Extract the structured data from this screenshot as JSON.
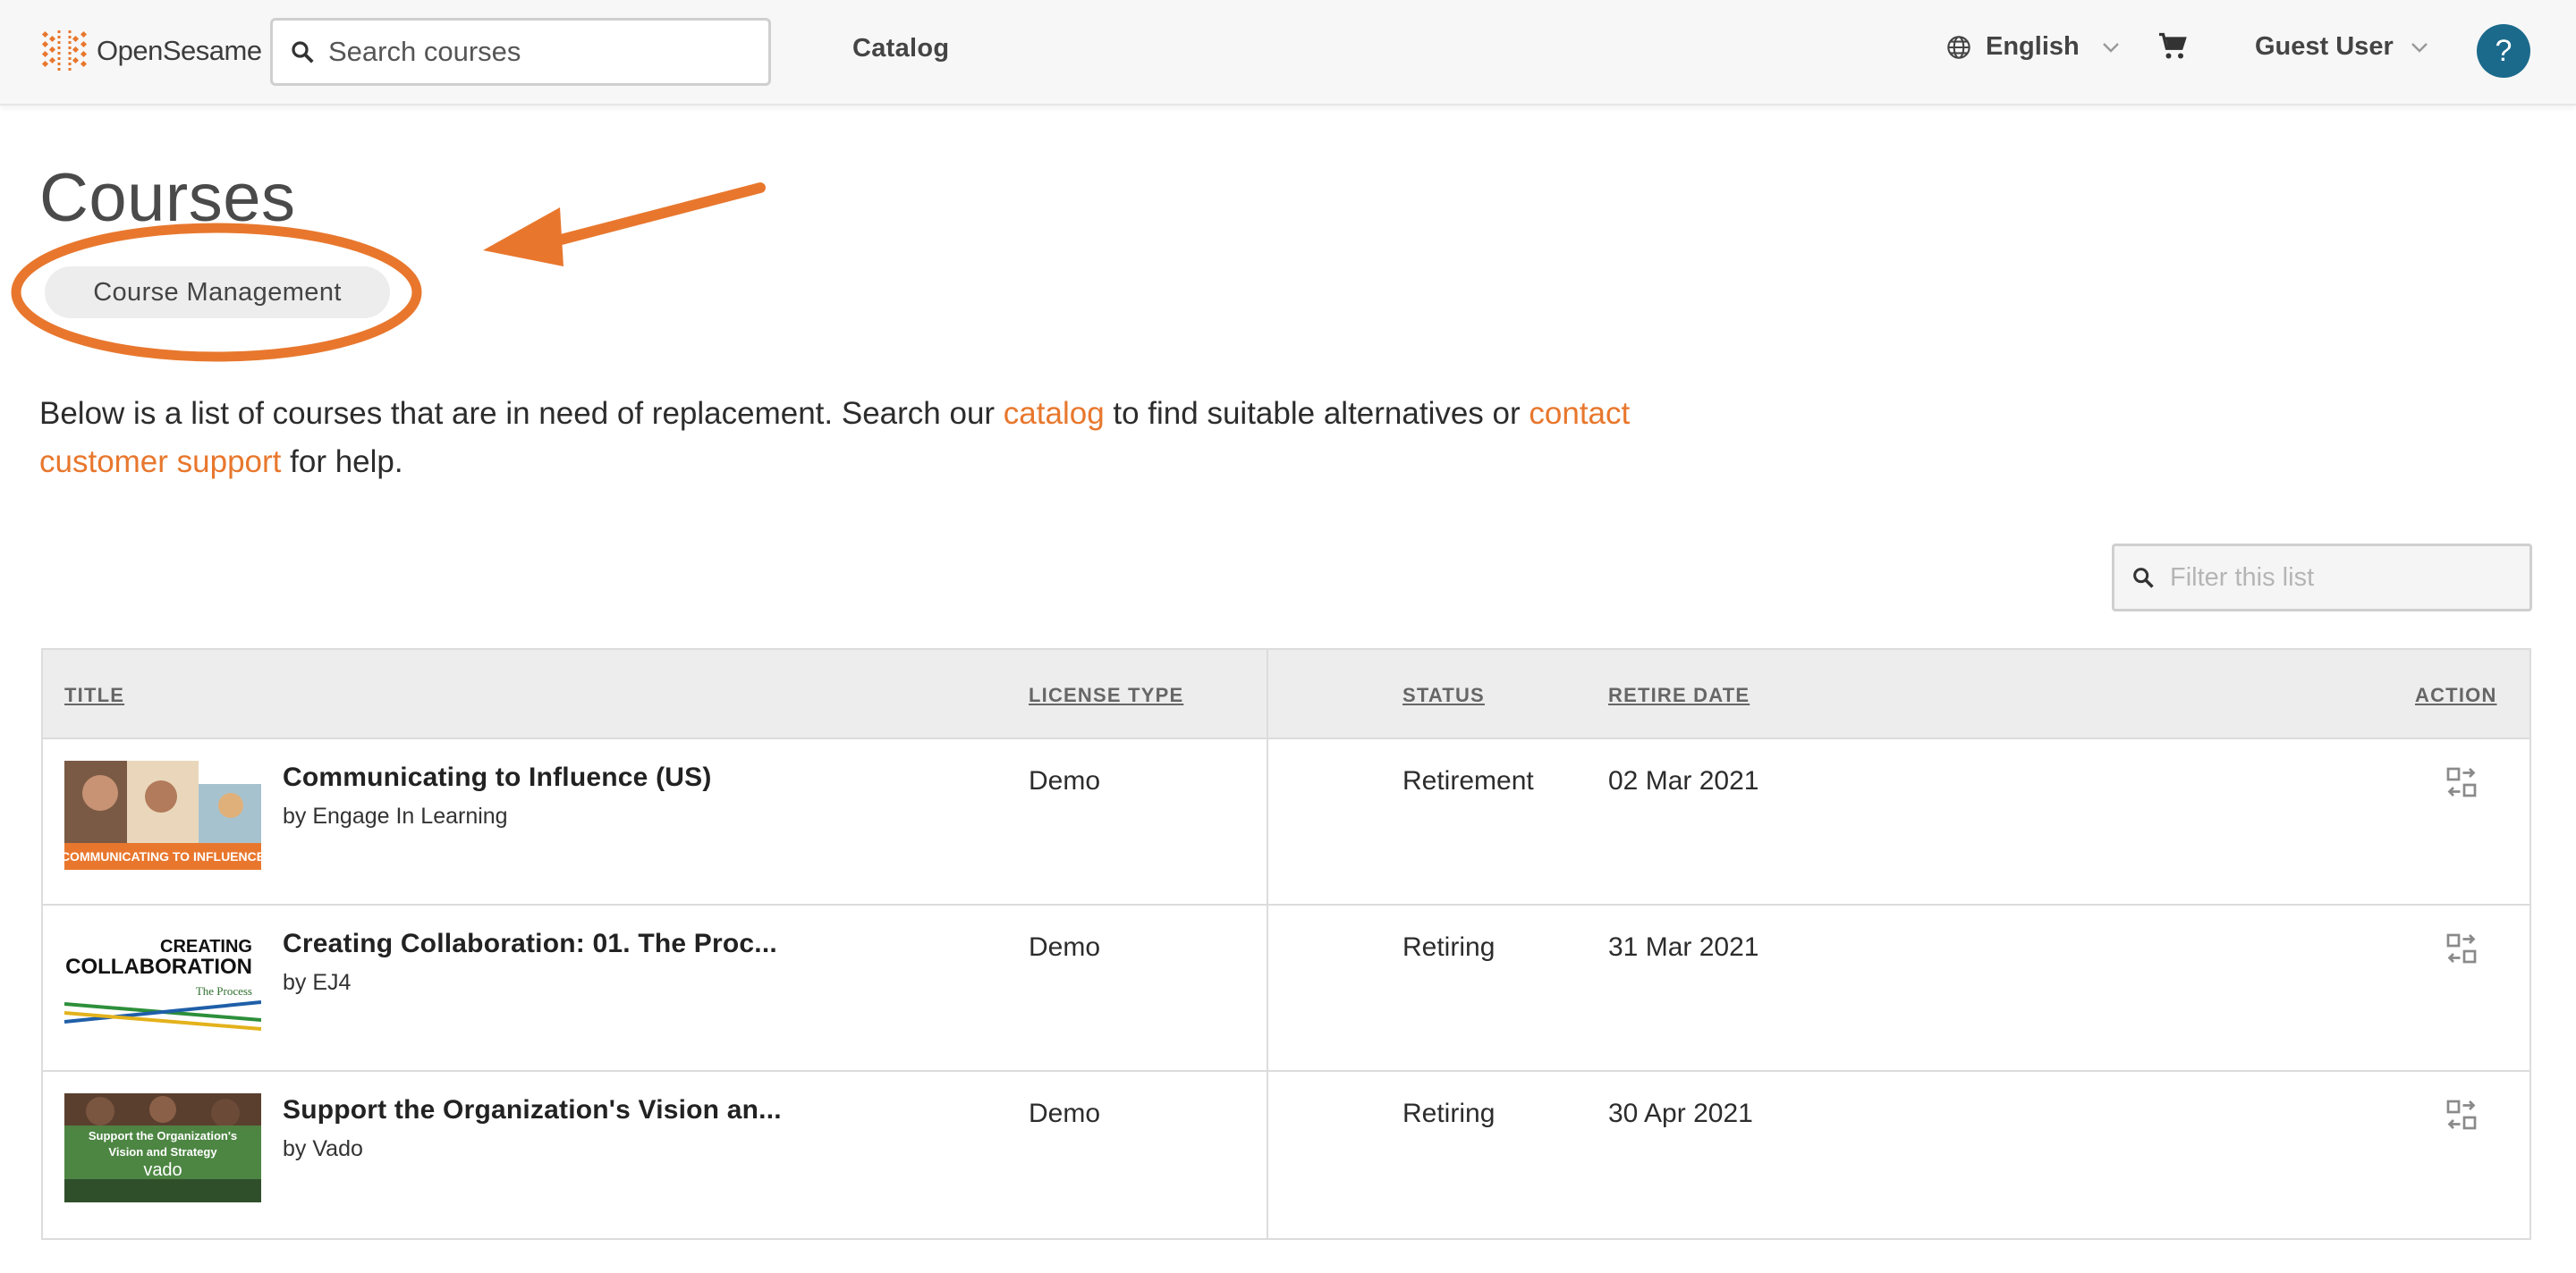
{
  "brand": {
    "name_prefix": "Open",
    "name_suffix": "Sesame",
    "accent": "#e8772d"
  },
  "header": {
    "search_placeholder": "Search courses",
    "nav_catalog": "Catalog",
    "language": "English",
    "user": "Guest User",
    "help": "?"
  },
  "page": {
    "title": "Courses",
    "pill": "Course Management",
    "intro": {
      "part1": "Below is a list of courses that are in need of replacement. Search our ",
      "link1": "catalog",
      "part2": " to find suitable alternatives or ",
      "link2": "contact customer support",
      "part3": " for help."
    },
    "filter_placeholder": "Filter this list"
  },
  "table": {
    "headers": {
      "title": "TITLE",
      "license": "LICENSE TYPE",
      "status": "STATUS",
      "retire": "RETIRE DATE",
      "action": "ACTION"
    },
    "rows": [
      {
        "title": "Communicating to Influence (US)",
        "author": "by Engage In Learning",
        "license": "Demo",
        "status": "Retirement",
        "date": "02 Mar 2021",
        "thumb_caption": "COMMUNICATING TO INFLUENCE"
      },
      {
        "title": "Creating Collaboration: 01. The Proc...",
        "author": "by EJ4",
        "license": "Demo",
        "status": "Retiring",
        "date": "31 Mar 2021",
        "thumb_caption_1": "CREATING",
        "thumb_caption_2": "COLLABORATION",
        "thumb_caption_3": "The Process"
      },
      {
        "title": "Support the Organization's Vision an...",
        "author": "by Vado",
        "license": "Demo",
        "status": "Retiring",
        "date": "30 Apr 2021",
        "thumb_caption_1": "Support the Organization's",
        "thumb_caption_2": "Vision and Strategy",
        "thumb_caption_3": "vado"
      }
    ]
  },
  "colors": {
    "help_button": "#1b6a8c",
    "annotation": "#e8772d",
    "header_bg": "#f7f7f7"
  }
}
